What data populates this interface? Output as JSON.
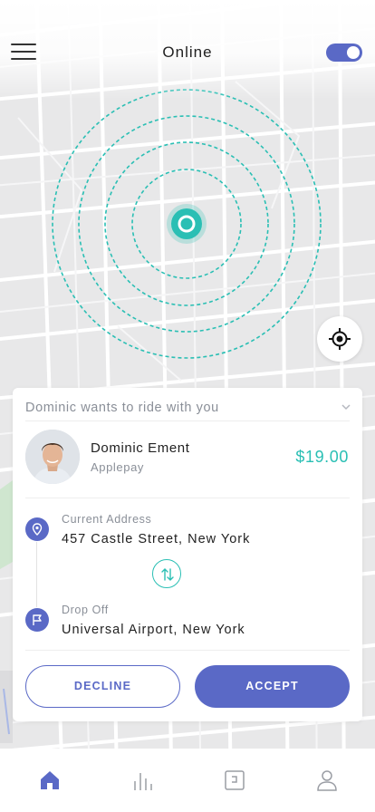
{
  "header": {
    "title": "Online",
    "online_toggle_on": true
  },
  "map": {
    "accent_color": "#2abfb4"
  },
  "ride_request": {
    "heading": "Dominic wants to ride with you",
    "rider_name": "Dominic Ement",
    "payment_method": "Applepay",
    "fare": "$19.00",
    "pickup_label": "Current Address",
    "pickup_address": "457 Castle Street, New York",
    "dropoff_label": "Drop Off",
    "dropoff_address": "Universal Airport, New York",
    "decline_label": "DECLINE",
    "accept_label": "ACCEPT"
  },
  "tabs": [
    {
      "icon": "home-icon",
      "active": true
    },
    {
      "icon": "bar-chart-icon",
      "active": false
    },
    {
      "icon": "wallet-icon",
      "active": false
    },
    {
      "icon": "profile-icon",
      "active": false
    }
  ],
  "colors": {
    "primary": "#5a69c6",
    "accent": "#2abfb4",
    "muted_text": "#8a8f98"
  }
}
